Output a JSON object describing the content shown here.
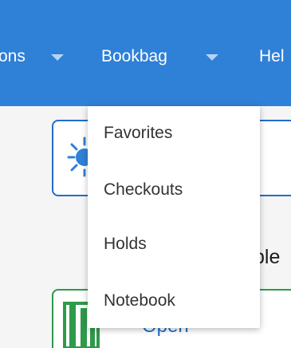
{
  "navbar": {
    "items": [
      {
        "label": "ons"
      },
      {
        "label": "Bookbag"
      },
      {
        "label": "Hel"
      }
    ]
  },
  "dropdown": {
    "items": [
      {
        "label": "Favorites"
      },
      {
        "label": "Checkouts"
      },
      {
        "label": "Holds"
      },
      {
        "label": "Notebook"
      }
    ]
  },
  "content": {
    "partial_text": "ple",
    "open_label": "Open"
  },
  "colors": {
    "navbar": "#2f80d7",
    "accent_blue": "#1f6fc8",
    "accent_green": "#2e9a4a"
  }
}
